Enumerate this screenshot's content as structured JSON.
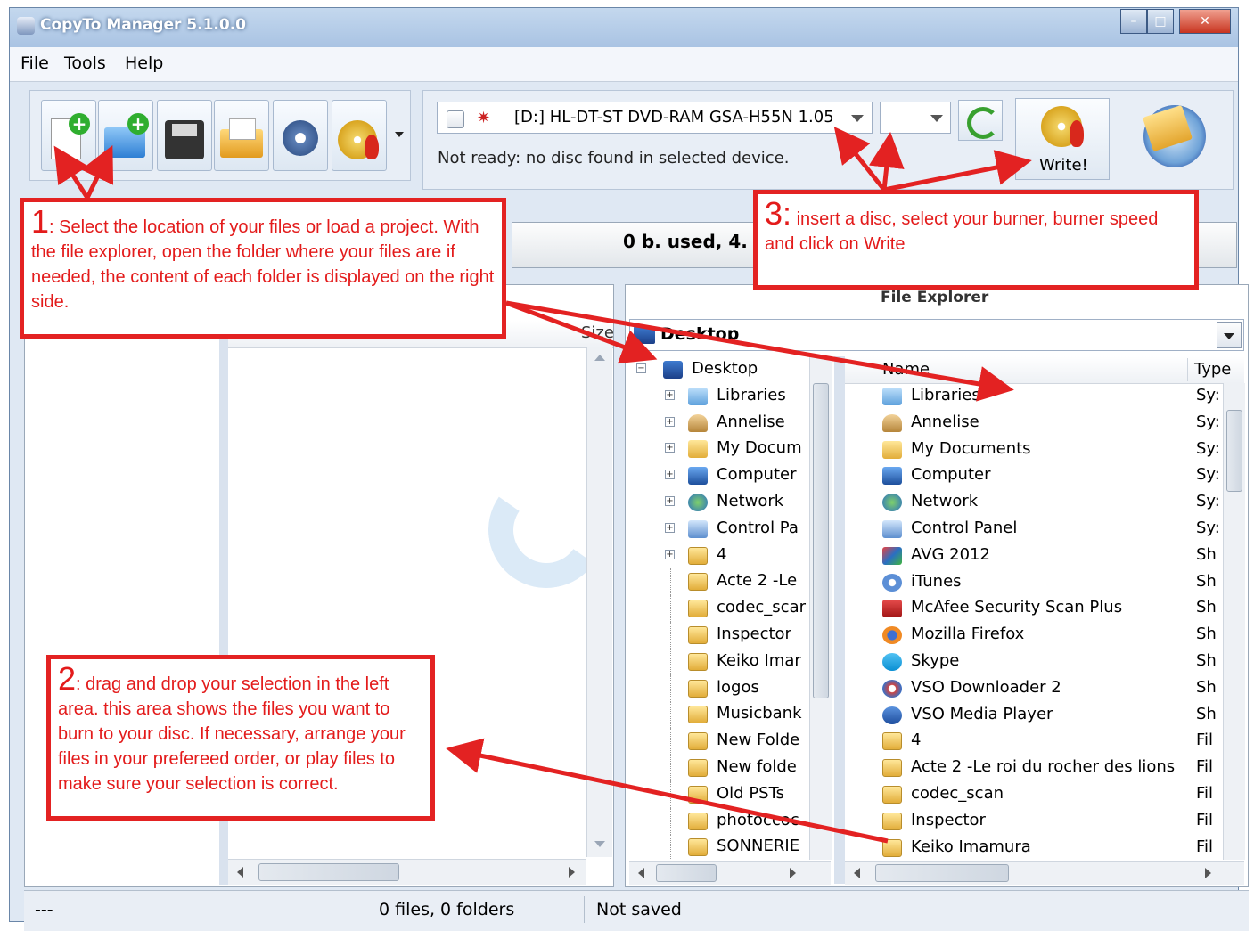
{
  "window": {
    "title": "CopyTo Manager 5.1.0.0"
  },
  "menu": [
    "File",
    "Tools",
    "Help"
  ],
  "toolbar": {
    "icons": [
      "add-files-icon",
      "add-folder-icon",
      "save-icon",
      "open-project-icon",
      "settings-icon",
      "burn-disc-icon",
      "dropdown-arrow-icon"
    ]
  },
  "burner": {
    "drive": "[D:] HL-DT-ST DVD-RAM GSA-H55N 1.05",
    "speed": "",
    "status": "Not ready: no disc found in selected device.",
    "write_label": "Write!"
  },
  "capacity": {
    "text": "0    b. used, 4."
  },
  "left_panel": {
    "size_header": "Size"
  },
  "explorer": {
    "title": "File Explorer",
    "location": "Desktop",
    "tree": [
      {
        "label": "Desktop",
        "icon": "desktop-icon"
      },
      {
        "label": "Libraries",
        "icon": "libraries-icon"
      },
      {
        "label": "Annelise",
        "icon": "user-icon"
      },
      {
        "label": "My Docum",
        "icon": "documents-icon"
      },
      {
        "label": "Computer",
        "icon": "computer-icon"
      },
      {
        "label": "Network",
        "icon": "network-icon"
      },
      {
        "label": "Control Pa",
        "icon": "control-panel-icon"
      },
      {
        "label": "4",
        "icon": "folder-icon"
      },
      {
        "label": "Acte 2 -Le",
        "icon": "folder-icon"
      },
      {
        "label": "codec_scar",
        "icon": "folder-icon"
      },
      {
        "label": "Inspector",
        "icon": "folder-icon"
      },
      {
        "label": "Keiko Imar",
        "icon": "folder-icon"
      },
      {
        "label": "logos",
        "icon": "folder-icon"
      },
      {
        "label": "Musicbank",
        "icon": "folder-icon"
      },
      {
        "label": "New Folde",
        "icon": "folder-icon"
      },
      {
        "label": "New folde",
        "icon": "folder-icon"
      },
      {
        "label": "Old PSTs",
        "icon": "folder-icon"
      },
      {
        "label": "photoccoc",
        "icon": "folder-icon"
      },
      {
        "label": "SONNERIE",
        "icon": "folder-icon"
      }
    ],
    "columns": {
      "name": "Name",
      "type": "Type"
    },
    "files": [
      {
        "name": "Libraries",
        "type": "Sy:",
        "icon": "libraries-icon"
      },
      {
        "name": "Annelise",
        "type": "Sy:",
        "icon": "user-icon"
      },
      {
        "name": "My Documents",
        "type": "Sy:",
        "icon": "documents-icon"
      },
      {
        "name": "Computer",
        "type": "Sy:",
        "icon": "computer-icon"
      },
      {
        "name": "Network",
        "type": "Sy:",
        "icon": "network-icon"
      },
      {
        "name": "Control Panel",
        "type": "Sy:",
        "icon": "control-panel-icon"
      },
      {
        "name": "AVG 2012",
        "type": "Sh",
        "icon": "avg-shortcut-icon"
      },
      {
        "name": "iTunes",
        "type": "Sh",
        "icon": "itunes-shortcut-icon"
      },
      {
        "name": "McAfee Security Scan Plus",
        "type": "Sh",
        "icon": "mcafee-shortcut-icon"
      },
      {
        "name": "Mozilla Firefox",
        "type": "Sh",
        "icon": "firefox-shortcut-icon"
      },
      {
        "name": "Skype",
        "type": "Sh",
        "icon": "skype-shortcut-icon"
      },
      {
        "name": "VSO Downloader 2",
        "type": "Sh",
        "icon": "vso-downloader-shortcut-icon"
      },
      {
        "name": "VSO Media Player",
        "type": "Sh",
        "icon": "vso-player-shortcut-icon"
      },
      {
        "name": "4",
        "type": "Fil",
        "icon": "folder-icon"
      },
      {
        "name": "Acte 2 -Le roi du rocher des lions",
        "type": "Fil",
        "icon": "folder-icon"
      },
      {
        "name": "codec_scan",
        "type": "Fil",
        "icon": "folder-icon"
      },
      {
        "name": "Inspector",
        "type": "Fil",
        "icon": "folder-icon"
      },
      {
        "name": "Keiko Imamura",
        "type": "Fil",
        "icon": "folder-icon"
      }
    ]
  },
  "callouts": [
    {
      "num": "1",
      "text": ": Select the location of your files or load a project. With the file explorer, open the folder where your files are if needed, the content of each folder is displayed on the right side."
    },
    {
      "num": "2",
      "text": ": drag and drop your selection in the left area. this area shows the files you want to burn to your disc. If necessary, arrange your files in your prefereed order, or play files to make sure your selection is correct."
    },
    {
      "num": "3:",
      "text": "  insert a disc, select your burner, burner speed and click on Write"
    }
  ],
  "statusbar": {
    "left": "---",
    "count": "0 files, 0 folders",
    "saved": "Not saved"
  },
  "colors": {
    "annotation": "#e32222",
    "titlebar": "#a9c3e3",
    "window_bg": "#dfe8f3"
  }
}
